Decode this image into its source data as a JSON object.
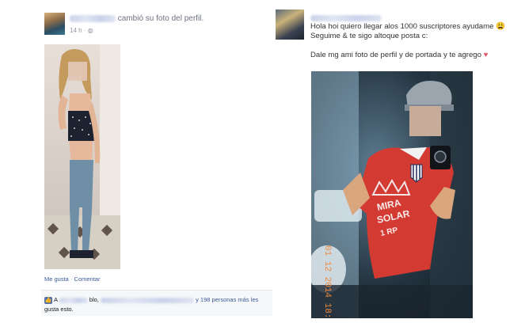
{
  "left_post": {
    "action_text": "cambió su foto del perfil.",
    "time": "14 h ·",
    "privacy_icon": "globe-icon",
    "actions": {
      "like": "Me gusta",
      "separator": "·",
      "comment": "Comentar"
    },
    "likes": {
      "prefix": "A",
      "mid_text": "blo,",
      "others": "y 198 personas más les",
      "suffix": "gusta esto."
    }
  },
  "right_post": {
    "line1": "Hola hoi quiero llegar alos 1000 suscriptores ayudame",
    "line1_emoji": "😩",
    "line2": "Seguime & te sigo altoque posta c:",
    "line3": "Dale mg ami foto de perfil y de portada y te agrego",
    "line3_emoji": "♥",
    "photo_timestamp": "01 12 2014 18:2",
    "jersey": {
      "text1": "MIRA",
      "text2": "SOLAR",
      "text3": "1 RP"
    }
  },
  "colors": {
    "link": "#3b5998",
    "muted": "#9197a3",
    "jersey_red": "#d23a32",
    "timestamp_orange": "#f08a3a"
  }
}
